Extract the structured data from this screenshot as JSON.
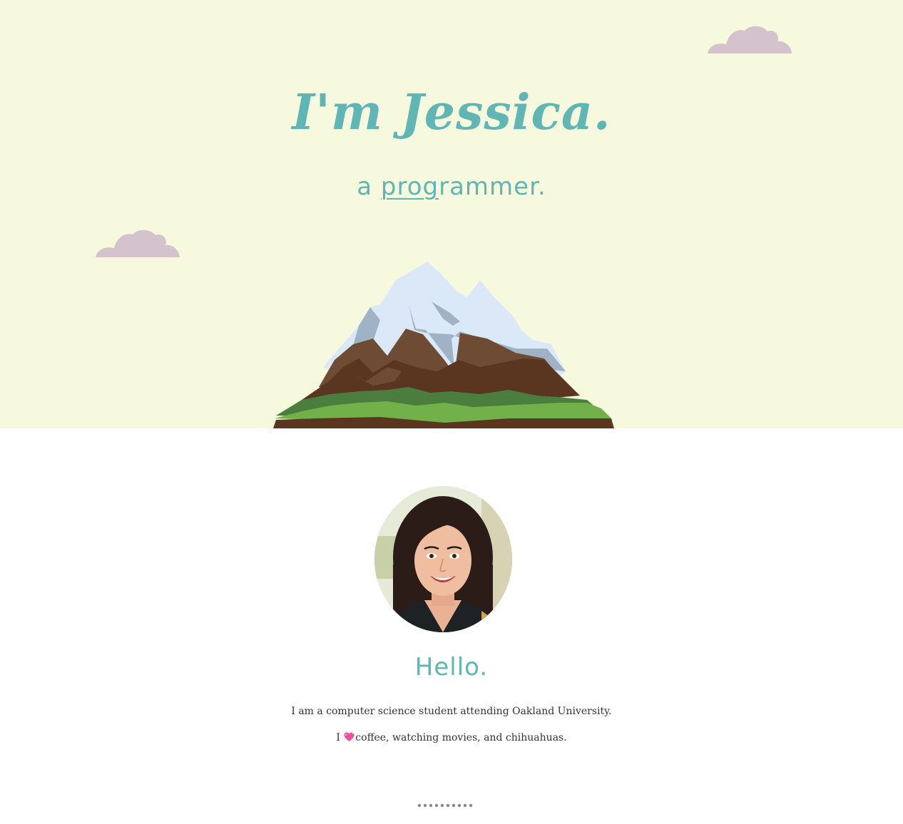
{
  "hero": {
    "title": "I'm Jessica.",
    "subtitle_prefix": "a ",
    "subtitle_typed": "prog",
    "subtitle_rest": "rammer.",
    "background_color": "#f6f9de",
    "accent_color": "#5fb6b4",
    "cloud_color": "#d4c3cd"
  },
  "about": {
    "heading": "Hello.",
    "bio_line1": "I am a computer science student attending Oakland University.",
    "bio_line2_prefix": "I ",
    "bio_heart_icon": "sparkling-heart-icon",
    "bio_line2_suffix": "coffee, watching movies, and chihuahuas.",
    "avatar_icon": "profile-photo"
  },
  "pagination": {
    "dot_count": 10,
    "dot_color": "#888888"
  }
}
